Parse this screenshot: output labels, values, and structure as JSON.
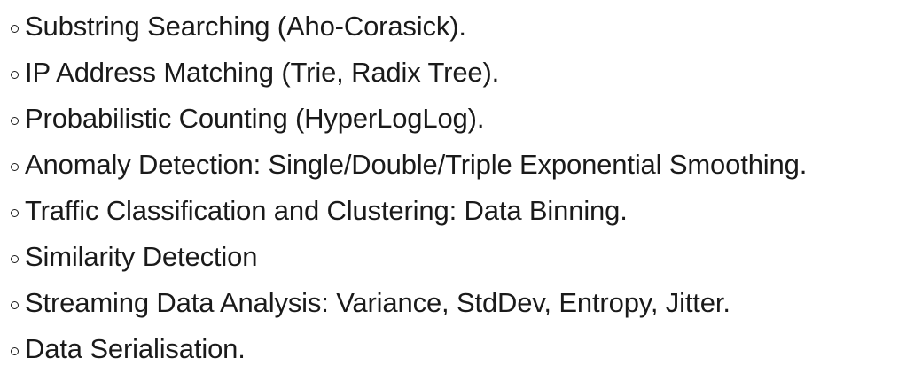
{
  "list": {
    "items": [
      {
        "text": "Substring Searching (Aho-Corasick)."
      },
      {
        "text": "IP Address Matching (Trie, Radix Tree)."
      },
      {
        "text": "Probabilistic Counting (HyperLogLog)."
      },
      {
        "text": "Anomaly Detection: Single/Double/Triple Exponential Smoothing."
      },
      {
        "text": "Traffic Classification and Clustering: Data Binning."
      },
      {
        "text": "Similarity Detection"
      },
      {
        "text": "Streaming Data Analysis: Variance, StdDev, Entropy, Jitter."
      },
      {
        "text": "Data Serialisation."
      }
    ]
  }
}
